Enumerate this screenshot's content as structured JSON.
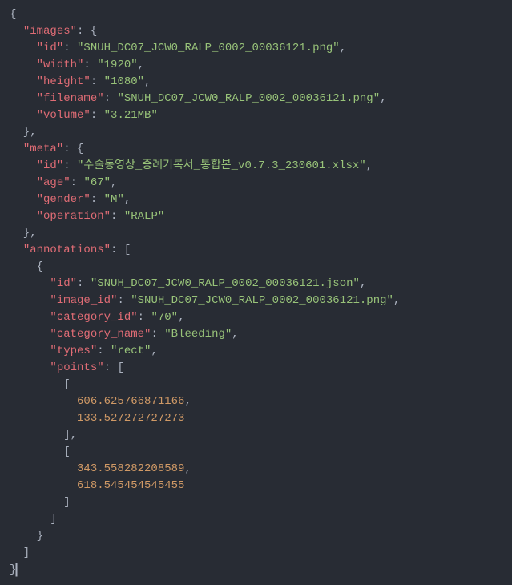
{
  "code_lines": [
    [
      {
        "cls": "punct",
        "t": "{"
      }
    ],
    [
      {
        "cls": "punct",
        "t": "  "
      },
      {
        "cls": "key",
        "t": "\"images\""
      },
      {
        "cls": "punct",
        "t": ": {"
      }
    ],
    [
      {
        "cls": "punct",
        "t": "    "
      },
      {
        "cls": "key",
        "t": "\"id\""
      },
      {
        "cls": "punct",
        "t": ": "
      },
      {
        "cls": "str",
        "t": "\"SNUH_DC07_JCW0_RALP_0002_00036121.png\""
      },
      {
        "cls": "punct",
        "t": ","
      }
    ],
    [
      {
        "cls": "punct",
        "t": "    "
      },
      {
        "cls": "key",
        "t": "\"width\""
      },
      {
        "cls": "punct",
        "t": ": "
      },
      {
        "cls": "str",
        "t": "\"1920\""
      },
      {
        "cls": "punct",
        "t": ","
      }
    ],
    [
      {
        "cls": "punct",
        "t": "    "
      },
      {
        "cls": "key",
        "t": "\"height\""
      },
      {
        "cls": "punct",
        "t": ": "
      },
      {
        "cls": "str",
        "t": "\"1080\""
      },
      {
        "cls": "punct",
        "t": ","
      }
    ],
    [
      {
        "cls": "punct",
        "t": "    "
      },
      {
        "cls": "key",
        "t": "\"filename\""
      },
      {
        "cls": "punct",
        "t": ": "
      },
      {
        "cls": "str",
        "t": "\"SNUH_DC07_JCW0_RALP_0002_00036121.png\""
      },
      {
        "cls": "punct",
        "t": ","
      }
    ],
    [
      {
        "cls": "punct",
        "t": "    "
      },
      {
        "cls": "key",
        "t": "\"volume\""
      },
      {
        "cls": "punct",
        "t": ": "
      },
      {
        "cls": "str",
        "t": "\"3.21MB\""
      }
    ],
    [
      {
        "cls": "punct",
        "t": "  },"
      }
    ],
    [
      {
        "cls": "punct",
        "t": "  "
      },
      {
        "cls": "key",
        "t": "\"meta\""
      },
      {
        "cls": "punct",
        "t": ": {"
      }
    ],
    [
      {
        "cls": "punct",
        "t": "    "
      },
      {
        "cls": "key",
        "t": "\"id\""
      },
      {
        "cls": "punct",
        "t": ": "
      },
      {
        "cls": "str",
        "t": "\"수술동영상_증례기록서_통합본_v0.7.3_230601.xlsx\""
      },
      {
        "cls": "punct",
        "t": ","
      }
    ],
    [
      {
        "cls": "punct",
        "t": "    "
      },
      {
        "cls": "key",
        "t": "\"age\""
      },
      {
        "cls": "punct",
        "t": ": "
      },
      {
        "cls": "str",
        "t": "\"67\""
      },
      {
        "cls": "punct",
        "t": ","
      }
    ],
    [
      {
        "cls": "punct",
        "t": "    "
      },
      {
        "cls": "key",
        "t": "\"gender\""
      },
      {
        "cls": "punct",
        "t": ": "
      },
      {
        "cls": "str",
        "t": "\"M\""
      },
      {
        "cls": "punct",
        "t": ","
      }
    ],
    [
      {
        "cls": "punct",
        "t": "    "
      },
      {
        "cls": "key",
        "t": "\"operation\""
      },
      {
        "cls": "punct",
        "t": ": "
      },
      {
        "cls": "str",
        "t": "\"RALP\""
      }
    ],
    [
      {
        "cls": "punct",
        "t": "  },"
      }
    ],
    [
      {
        "cls": "punct",
        "t": "  "
      },
      {
        "cls": "key",
        "t": "\"annotations\""
      },
      {
        "cls": "punct",
        "t": ": ["
      }
    ],
    [
      {
        "cls": "punct",
        "t": "    {"
      }
    ],
    [
      {
        "cls": "punct",
        "t": "      "
      },
      {
        "cls": "key",
        "t": "\"id\""
      },
      {
        "cls": "punct",
        "t": ": "
      },
      {
        "cls": "str",
        "t": "\"SNUH_DC07_JCW0_RALP_0002_00036121.json\""
      },
      {
        "cls": "punct",
        "t": ","
      }
    ],
    [
      {
        "cls": "punct",
        "t": "      "
      },
      {
        "cls": "key",
        "t": "\"image_id\""
      },
      {
        "cls": "punct",
        "t": ": "
      },
      {
        "cls": "str",
        "t": "\"SNUH_DC07_JCW0_RALP_0002_00036121.png\""
      },
      {
        "cls": "punct",
        "t": ","
      }
    ],
    [
      {
        "cls": "punct",
        "t": "      "
      },
      {
        "cls": "key",
        "t": "\"category_id\""
      },
      {
        "cls": "punct",
        "t": ": "
      },
      {
        "cls": "str",
        "t": "\"70\""
      },
      {
        "cls": "punct",
        "t": ","
      }
    ],
    [
      {
        "cls": "punct",
        "t": "      "
      },
      {
        "cls": "key",
        "t": "\"category_name\""
      },
      {
        "cls": "punct",
        "t": ": "
      },
      {
        "cls": "str",
        "t": "\"Bleeding\""
      },
      {
        "cls": "punct",
        "t": ","
      }
    ],
    [
      {
        "cls": "punct",
        "t": "      "
      },
      {
        "cls": "key",
        "t": "\"types\""
      },
      {
        "cls": "punct",
        "t": ": "
      },
      {
        "cls": "str",
        "t": "\"rect\""
      },
      {
        "cls": "punct",
        "t": ","
      }
    ],
    [
      {
        "cls": "punct",
        "t": "      "
      },
      {
        "cls": "key",
        "t": "\"points\""
      },
      {
        "cls": "punct",
        "t": ": ["
      }
    ],
    [
      {
        "cls": "punct",
        "t": "        ["
      }
    ],
    [
      {
        "cls": "punct",
        "t": "          "
      },
      {
        "cls": "num",
        "t": "606.625766871166"
      },
      {
        "cls": "punct",
        "t": ","
      }
    ],
    [
      {
        "cls": "punct",
        "t": "          "
      },
      {
        "cls": "num",
        "t": "133.527272727273"
      }
    ],
    [
      {
        "cls": "punct",
        "t": "        ],"
      }
    ],
    [
      {
        "cls": "punct",
        "t": "        ["
      }
    ],
    [
      {
        "cls": "punct",
        "t": "          "
      },
      {
        "cls": "num",
        "t": "343.558282208589"
      },
      {
        "cls": "punct",
        "t": ","
      }
    ],
    [
      {
        "cls": "punct",
        "t": "          "
      },
      {
        "cls": "num",
        "t": "618.545454545455"
      }
    ],
    [
      {
        "cls": "punct",
        "t": "        ]"
      }
    ],
    [
      {
        "cls": "punct",
        "t": "      ]"
      }
    ],
    [
      {
        "cls": "punct",
        "t": "    }"
      }
    ],
    [
      {
        "cls": "punct",
        "t": "  ]"
      }
    ],
    [
      {
        "cls": "punct",
        "t": "}"
      },
      {
        "cls": "cursor",
        "t": ""
      }
    ]
  ]
}
